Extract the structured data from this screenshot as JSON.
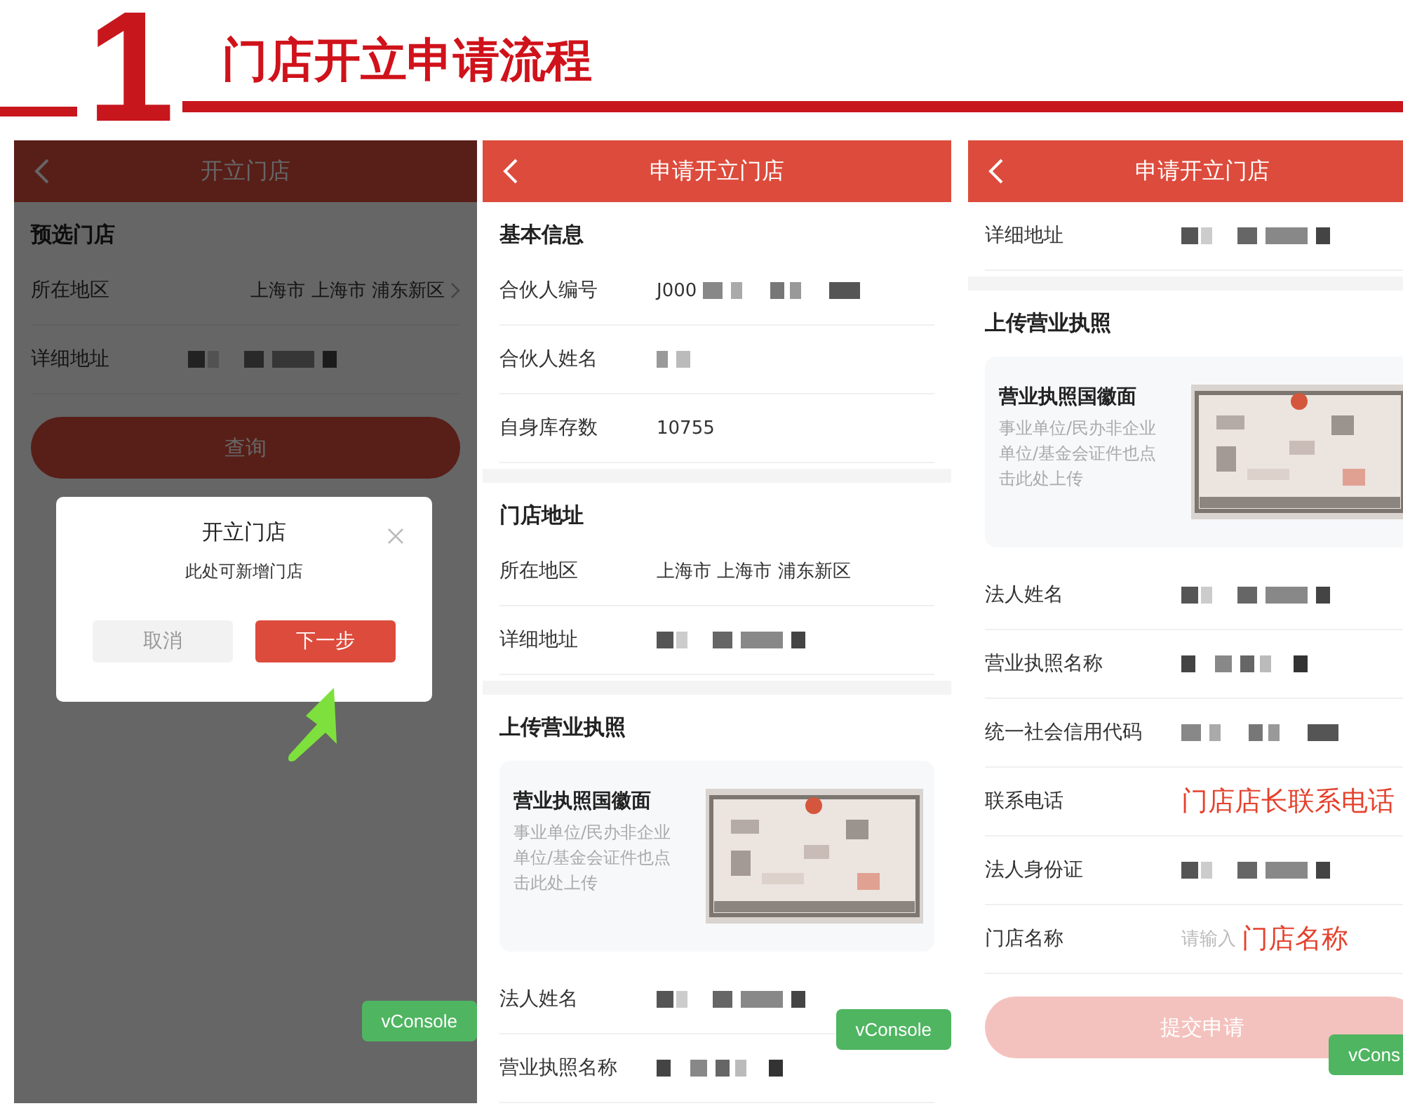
{
  "header": {
    "step": "1",
    "title": "门店开立申请流程"
  },
  "screens": [
    {
      "nav_title": "开立门店",
      "items": [
        {
          "kind": "section",
          "text": "预选门店"
        },
        {
          "kind": "row",
          "label": "所在地区",
          "value": "上海市 上海市 浦东新区",
          "redacted": false,
          "chevron": true
        },
        {
          "kind": "row",
          "label": "详细地址",
          "redacted": true,
          "chevron": false
        },
        {
          "kind": "button",
          "text": "查询",
          "disabled": false
        }
      ],
      "dialog": {
        "title": "开立门店",
        "message": "此处可新增门店",
        "cancel": "取消",
        "confirm": "下一步"
      },
      "vconsole": "vConsole"
    },
    {
      "nav_title": "申请开立门店",
      "items": [
        {
          "kind": "section",
          "text": "基本信息"
        },
        {
          "kind": "row",
          "label": "合伙人编号",
          "value": "J000",
          "redacted": true,
          "chevron": false
        },
        {
          "kind": "row",
          "label": "合伙人姓名",
          "redacted": true,
          "chevron": false
        },
        {
          "kind": "row",
          "label": "自身库存数",
          "value": "10755",
          "redacted": false,
          "chevron": false
        },
        {
          "kind": "gap"
        },
        {
          "kind": "section",
          "text": "门店地址"
        },
        {
          "kind": "row",
          "label": "所在地区",
          "value": "上海市 上海市 浦东新区",
          "redacted": false,
          "chevron": false
        },
        {
          "kind": "row",
          "label": "详细地址",
          "redacted": true,
          "chevron": false
        },
        {
          "kind": "gap"
        },
        {
          "kind": "section",
          "text": "上传营业执照"
        },
        {
          "kind": "upload",
          "title": "营业执照国徽面",
          "hint": "事业单位/民办非企业单位/基金会证件也点击此处上传"
        },
        {
          "kind": "row",
          "label": "法人姓名",
          "redacted": true,
          "chevron": false
        },
        {
          "kind": "row",
          "label": "营业执照名称",
          "redacted": true,
          "chevron": false
        }
      ],
      "vconsole": "vConsole"
    },
    {
      "nav_title": "申请开立门店",
      "items": [
        {
          "kind": "row",
          "label": "详细地址",
          "redacted": true,
          "chevron": false
        },
        {
          "kind": "gap"
        },
        {
          "kind": "section",
          "text": "上传营业执照"
        },
        {
          "kind": "upload",
          "title": "营业执照国徽面",
          "hint": "事业单位/民办非企业单位/基金会证件也点击此处上传"
        },
        {
          "kind": "row",
          "label": "法人姓名",
          "redacted": true,
          "chevron": false
        },
        {
          "kind": "row",
          "label": "营业执照名称",
          "redacted": true,
          "chevron": false
        },
        {
          "kind": "row",
          "label": "统一社会信用代码",
          "redacted": true,
          "chevron": false
        },
        {
          "kind": "row",
          "label": "联系电话",
          "redacted": false,
          "chevron": false,
          "annotation": "门店店长联系电话"
        },
        {
          "kind": "row",
          "label": "法人身份证",
          "redacted": true,
          "chevron": false
        },
        {
          "kind": "row",
          "label": "门店名称",
          "redacted": false,
          "chevron": false,
          "placeholder": "请输入",
          "annotation": "门店名称"
        },
        {
          "kind": "button",
          "text": "提交申请",
          "disabled": true
        }
      ],
      "vconsole": "vCons"
    }
  ]
}
